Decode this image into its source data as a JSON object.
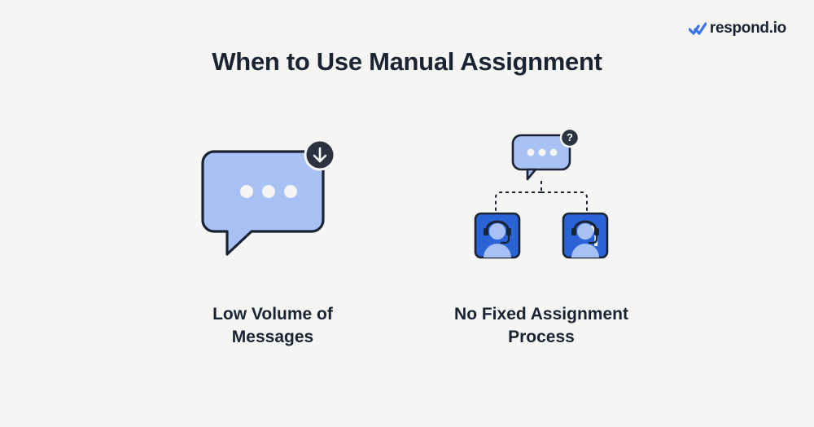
{
  "brand": {
    "name": "respond.io"
  },
  "title": "When to Use Manual Assignment",
  "items": [
    {
      "caption": "Low Volume of Messages"
    },
    {
      "caption": "No Fixed Assignment Process"
    }
  ],
  "colors": {
    "bg": "#f5f5f4",
    "text": "#1a2332",
    "blueLight": "#a7c1f4",
    "blueDark": "#2a63d6",
    "badgeDark": "#2a333f",
    "accent": "#3a72e8"
  }
}
